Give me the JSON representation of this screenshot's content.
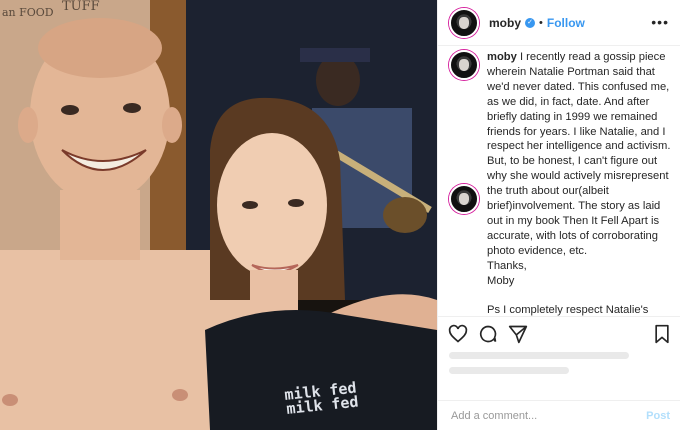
{
  "post": {
    "username": "moby",
    "follow_label": "Follow",
    "separator": "•",
    "more_label": "•••",
    "verified_glyph": "✓",
    "caption_intro": "I recently read a gossip piece wherein Natalie Portman said that we'd never dated. This confused me, as we did, in fact, date. And after briefly dating in 1999 we remained friends for years. I like Natalie, and I respect her intelligence and activism. But, to be honest, I can't figure out why she would actively misrepresent the truth about our(albeit brief)involvement. The story as laid out in my book Then It Fell Apart is accurate, with lots of corroborating photo evidence, etc.",
    "caption_thanks": "Thanks,",
    "caption_sign": "Moby",
    "caption_ps": "Ps I completely respect Natalie's possible regret in dating me(to be fair, I would probably regret dating me, too), but it doesn't alter the actual facts of",
    "comment_placeholder": "Add a comment...",
    "post_button": "Post"
  },
  "photo": {
    "shirt_text": "milk fed"
  },
  "icons": {
    "like": "heart-icon",
    "comment": "comment-icon",
    "share": "share-icon",
    "save": "bookmark-icon"
  },
  "colors": {
    "link_blue": "#3897f0",
    "post_disabled": "#b2dffc",
    "text": "#262626"
  }
}
